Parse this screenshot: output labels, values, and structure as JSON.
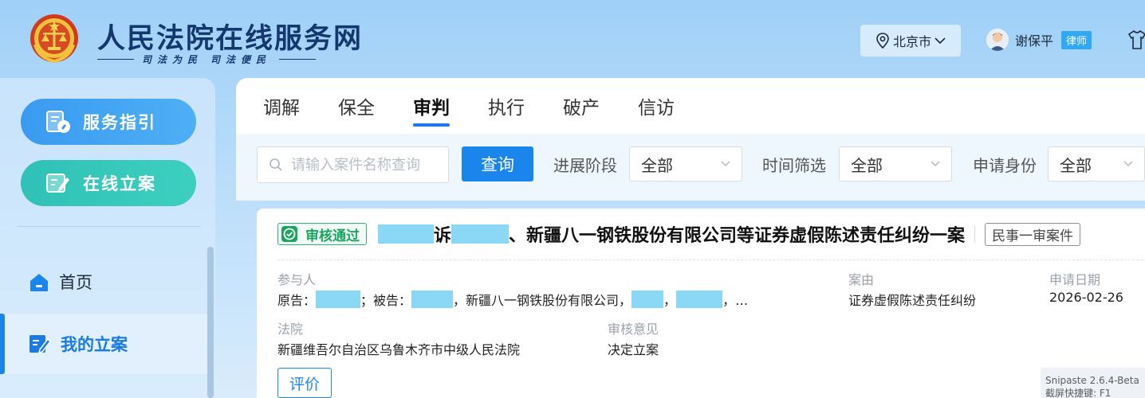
{
  "header": {
    "site_title": "人民法院在线服务网",
    "motto_left": "司法为民",
    "motto_right": "司法便民",
    "city": "北京市",
    "user_name": "谢保平",
    "user_role": "律师"
  },
  "sidebar": {
    "guide_label": "服务指引",
    "file_case_label": "在线立案",
    "items": [
      {
        "label": "首页"
      },
      {
        "label": "我的立案"
      }
    ]
  },
  "tabs": [
    {
      "label": "调解"
    },
    {
      "label": "保全"
    },
    {
      "label": "审判"
    },
    {
      "label": "执行"
    },
    {
      "label": "破产"
    },
    {
      "label": "信访"
    }
  ],
  "filters": {
    "search_placeholder": "请输入案件名称查询",
    "query_label": "查询",
    "stage_label": "进展阶段",
    "stage_value": "全部",
    "time_label": "时间筛选",
    "time_value": "全部",
    "identity_label": "申请身份",
    "identity_value": "全部"
  },
  "case": {
    "status": "审核通过",
    "title_part1": "诉",
    "title_part2": "、新疆八一钢铁股份有限公司等证券虚假陈述责任纠纷一案",
    "case_type": "民事一审案件",
    "participants_label": "参与人",
    "plaintiff_prefix": "原告：",
    "defendant_prefix": "；被告：",
    "defendant_company": "，新疆八一钢铁股份有限公司，",
    "comma": "，",
    "comma_ellipsis": "，…",
    "cause_label": "案由",
    "cause_value": "证券虚假陈述责任纠纷",
    "date_label": "申请日期",
    "date_value": "2026-02-26",
    "court_label": "法院",
    "court_value": "新疆维吾尔自治区乌鲁木齐市中级人民法院",
    "review_label": "审核意见",
    "review_value": "决定立案",
    "rate_label": "评价"
  },
  "overlay": {
    "snipaste_line1": "Snipaste 2.6.4-Beta",
    "snipaste_line2": "截屏快捷键: F1"
  },
  "colors": {
    "primary": "#1a86ec",
    "success": "#19a45f",
    "title_navy": "#14376e"
  }
}
